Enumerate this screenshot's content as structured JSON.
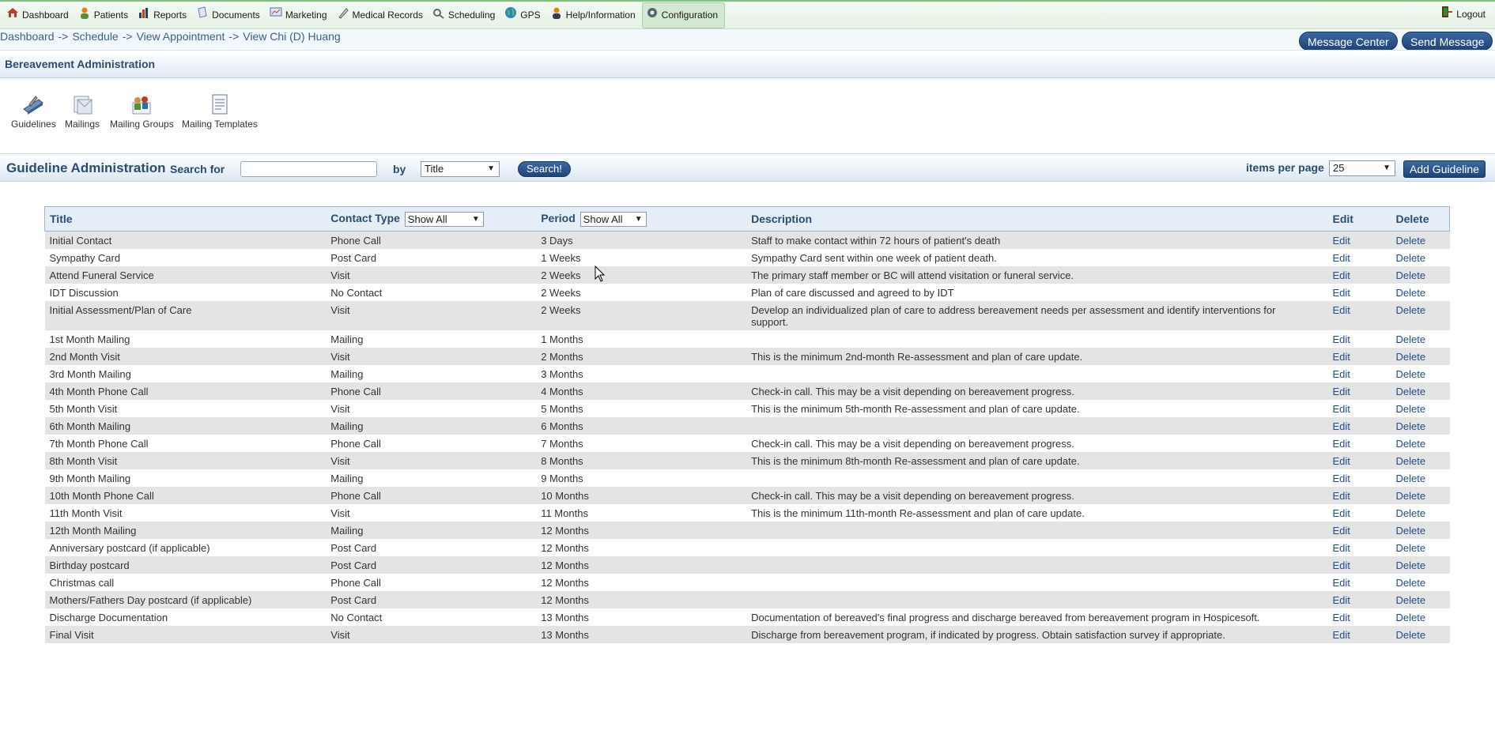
{
  "nav": {
    "items": [
      {
        "label": "Dashboard",
        "icon": "house-icon",
        "color": "#c0392b"
      },
      {
        "label": "Patients",
        "icon": "person-icon",
        "color": "#e67e22"
      },
      {
        "label": "Reports",
        "icon": "bar-chart-icon",
        "color": "#2c3e50"
      },
      {
        "label": "Documents",
        "icon": "document-icon",
        "color": "#5b7fb5"
      },
      {
        "label": "Marketing",
        "icon": "chart-board-icon",
        "color": "#4a6fa5"
      },
      {
        "label": "Medical Records",
        "icon": "quill-icon",
        "color": "#555555"
      },
      {
        "label": "Scheduling",
        "icon": "gear-wrench-icon",
        "color": "#666666"
      },
      {
        "label": "GPS",
        "icon": "globe-icon",
        "color": "#2e86c1"
      },
      {
        "label": "Help/Information",
        "icon": "help-person-icon",
        "color": "#d68910"
      },
      {
        "label": "Configuration",
        "icon": "config-gear-icon",
        "color": "#566573"
      }
    ],
    "logout_label": "Logout"
  },
  "breadcrumb": {
    "parts": [
      "Dashboard",
      "Schedule",
      "View Appointment",
      "View Chi (D) Huang"
    ],
    "separator": "->"
  },
  "header_buttons": {
    "message_center": "Message Center",
    "send_message": "Send Message"
  },
  "section_title": "Bereavement Administration",
  "toolbar": {
    "items": [
      {
        "label": "Guidelines",
        "icon": "guidelines-icon"
      },
      {
        "label": "Mailings",
        "icon": "mailings-icon"
      },
      {
        "label": "Mailing Groups",
        "icon": "mailing-groups-icon"
      },
      {
        "label": "Mailing Templates",
        "icon": "mailing-templates-icon"
      }
    ]
  },
  "admin_bar": {
    "title": "Guideline Administration",
    "search_label": "Search for",
    "search_value": "",
    "by_label": "by",
    "by_selected": "Title",
    "search_button": "Search!",
    "items_per_page_label": "items per page",
    "items_per_page_value": "25",
    "add_button": "Add Guideline"
  },
  "table": {
    "headers": {
      "title": "Title",
      "contact_type": "Contact Type",
      "contact_filter": "Show All",
      "period": "Period",
      "period_filter": "Show All",
      "description": "Description",
      "edit": "Edit",
      "delete": "Delete"
    },
    "edit_label": "Edit",
    "delete_label": "Delete",
    "rows": [
      {
        "title": "Initial Contact",
        "contact": "Phone Call",
        "period": "3 Days",
        "desc": "Staff to make contact within 72 hours of patient's death"
      },
      {
        "title": "Sympathy Card",
        "contact": "Post Card",
        "period": "1 Weeks",
        "desc": "Sympathy Card sent within one week of patient death."
      },
      {
        "title": "Attend Funeral Service",
        "contact": "Visit",
        "period": "2 Weeks",
        "desc": "The primary staff member or BC will attend visitation or funeral service."
      },
      {
        "title": "IDT Discussion",
        "contact": "No Contact",
        "period": "2 Weeks",
        "desc": "Plan of care discussed and agreed to by IDT"
      },
      {
        "title": "Initial Assessment/Plan of Care",
        "contact": "Visit",
        "period": "2 Weeks",
        "desc": "Develop an individualized plan of care to address bereavement needs per assessment and identify interventions for support."
      },
      {
        "title": "1st Month Mailing",
        "contact": "Mailing",
        "period": "1 Months",
        "desc": ""
      },
      {
        "title": "2nd Month Visit",
        "contact": "Visit",
        "period": "2 Months",
        "desc": "This is the minimum 2nd-month Re-assessment and plan of care update."
      },
      {
        "title": "3rd Month Mailing",
        "contact": "Mailing",
        "period": "3 Months",
        "desc": ""
      },
      {
        "title": "4th Month Phone Call",
        "contact": "Phone Call",
        "period": "4 Months",
        "desc": "Check-in call. This may be a visit depending on bereavement progress."
      },
      {
        "title": "5th Month Visit",
        "contact": "Visit",
        "period": "5 Months",
        "desc": "This is the minimum 5th-month Re-assessment and plan of care update."
      },
      {
        "title": "6th Month Mailing",
        "contact": "Mailing",
        "period": "6 Months",
        "desc": ""
      },
      {
        "title": "7th Month Phone Call",
        "contact": "Phone Call",
        "period": "7 Months",
        "desc": "Check-in call. This may be a visit depending on bereavement progress."
      },
      {
        "title": "8th Month Visit",
        "contact": "Visit",
        "period": "8 Months",
        "desc": "This is the minimum 8th-month Re-assessment and plan of care update."
      },
      {
        "title": "9th Month Mailing",
        "contact": "Mailing",
        "period": "9 Months",
        "desc": ""
      },
      {
        "title": "10th Month Phone Call",
        "contact": "Phone Call",
        "period": "10 Months",
        "desc": "Check-in call. This may be a visit depending on bereavement progress."
      },
      {
        "title": "11th Month Visit",
        "contact": "Visit",
        "period": "11 Months",
        "desc": "This is the minimum 11th-month Re-assessment and plan of care update."
      },
      {
        "title": "12th Month Mailing",
        "contact": "Mailing",
        "period": "12 Months",
        "desc": ""
      },
      {
        "title": "Anniversary postcard (if applicable)",
        "contact": "Post Card",
        "period": "12 Months",
        "desc": ""
      },
      {
        "title": "Birthday postcard",
        "contact": "Post Card",
        "period": "12 Months",
        "desc": ""
      },
      {
        "title": "Christmas call",
        "contact": "Phone Call",
        "period": "12 Months",
        "desc": ""
      },
      {
        "title": "Mothers/Fathers Day postcard (if applicable)",
        "contact": "Post Card",
        "period": "12 Months",
        "desc": ""
      },
      {
        "title": "Discharge Documentation",
        "contact": "No Contact",
        "period": "13 Months",
        "desc": "Documentation of bereaved's final progress and discharge bereaved from bereavement program in Hospicesoft."
      },
      {
        "title": "Final Visit",
        "contact": "Visit",
        "period": "13 Months",
        "desc": "Discharge from bereavement program, if indicated by progress. Obtain satisfaction survey if appropriate."
      }
    ]
  },
  "colors": {
    "nav_accent": "#7cc47c",
    "header_text": "#2b4d72",
    "button_blue": "#1f4477",
    "link_blue": "#1f4d8a",
    "row_stripe": "#e4e4e4"
  }
}
